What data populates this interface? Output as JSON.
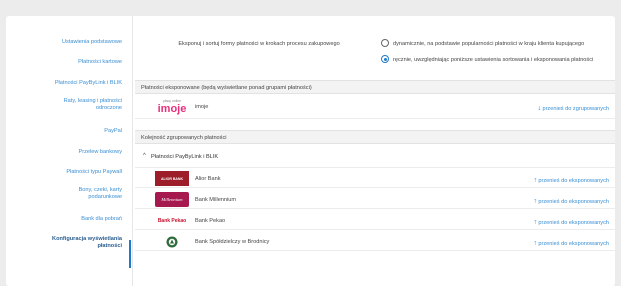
{
  "sidebar": {
    "items": [
      {
        "label": "Ustawienia podstawowe"
      },
      {
        "label": "Płatności kartowe"
      },
      {
        "label": "Płatności PayByLink i BLIK"
      },
      {
        "label": "Raty, leasing i płatności odroczone"
      },
      {
        "label": "PayPal"
      },
      {
        "label": "Przelew bankowy"
      },
      {
        "label": "Płatności typu Paywall"
      },
      {
        "label": "Bony, czeki, karty podarunkowe"
      },
      {
        "label": "Bank dla pobrań"
      },
      {
        "label": "Konfiguracja wyświetlania płatności"
      }
    ]
  },
  "settings": {
    "intro": "Eksponuj i sortuj formy płatności w krokach procesu zakupowego",
    "option_auto": "dynamicznie, na podstawie popularności płatności w kraju klienta kupującego",
    "option_manual": "ręcznie, uwzględniając poniższe ustawienia sortowania i eksponowania płatności"
  },
  "exposed": {
    "header": "Płatności eksponowane (będą wyświetlane ponad grupami płatności)",
    "items": [
      {
        "name": "imoje",
        "logo_top": "płacę online",
        "logo_main": "imoje",
        "action": "przenieś do zgrupowanych"
      }
    ]
  },
  "grouped": {
    "header": "Kolejność zgrupowanych płatności",
    "group_label": "Płatności PayByLink i BLIK",
    "items": [
      {
        "name": "Alior Bank",
        "logo": "ALIOR BANK",
        "action": "przenieś do eksponowanych"
      },
      {
        "name": "Bank Millennium",
        "logo": "Millennium",
        "action": "przenieś do eksponowanych"
      },
      {
        "name": "Bank Pekao",
        "logo": "Bank Pekao",
        "action": "przenieś do eksponowanych"
      },
      {
        "name": "Bank Spółdzielczy w Brodnicy",
        "logo": "",
        "action": "przenieś do eksponowanych"
      }
    ]
  },
  "colors": {
    "link": "#3b8fd3",
    "accent": "#1f7ac8",
    "imoje": "#e8317b",
    "alior": "#9d1d2a",
    "millennium": "#a6194f",
    "pekao": "#c8102e"
  },
  "icons": {
    "move_down": "arrow-down-icon",
    "move_up": "arrow-up-icon",
    "group_toggle": "chevron-up-icon"
  }
}
